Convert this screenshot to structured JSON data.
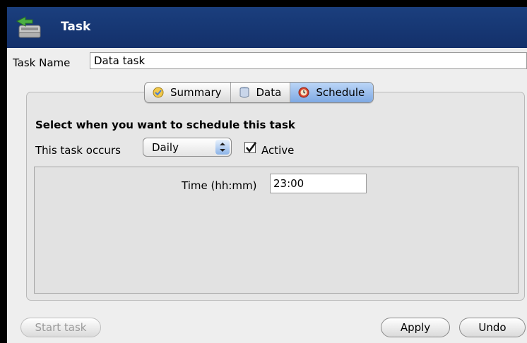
{
  "window": {
    "title": "Task",
    "title_icon": "task-icon",
    "titlebar_color": "#1b3f7e"
  },
  "task_name": {
    "label": "Task Name",
    "value": "Data task"
  },
  "tabs": [
    {
      "label": "Summary",
      "icon": "summary-icon",
      "selected": false
    },
    {
      "label": "Data",
      "icon": "data-icon",
      "selected": false
    },
    {
      "label": "Schedule",
      "icon": "schedule-icon",
      "selected": true
    }
  ],
  "schedule": {
    "heading": "Select when you want to schedule this task",
    "occurs_label": "This task occurs",
    "occurs_value": "Daily",
    "active_label": "Active",
    "active_checked": true,
    "time_label": "Time (hh:mm)",
    "time_value": "23:00"
  },
  "buttons": {
    "start_task": "Start task",
    "apply": "Apply",
    "undo": "Undo"
  }
}
